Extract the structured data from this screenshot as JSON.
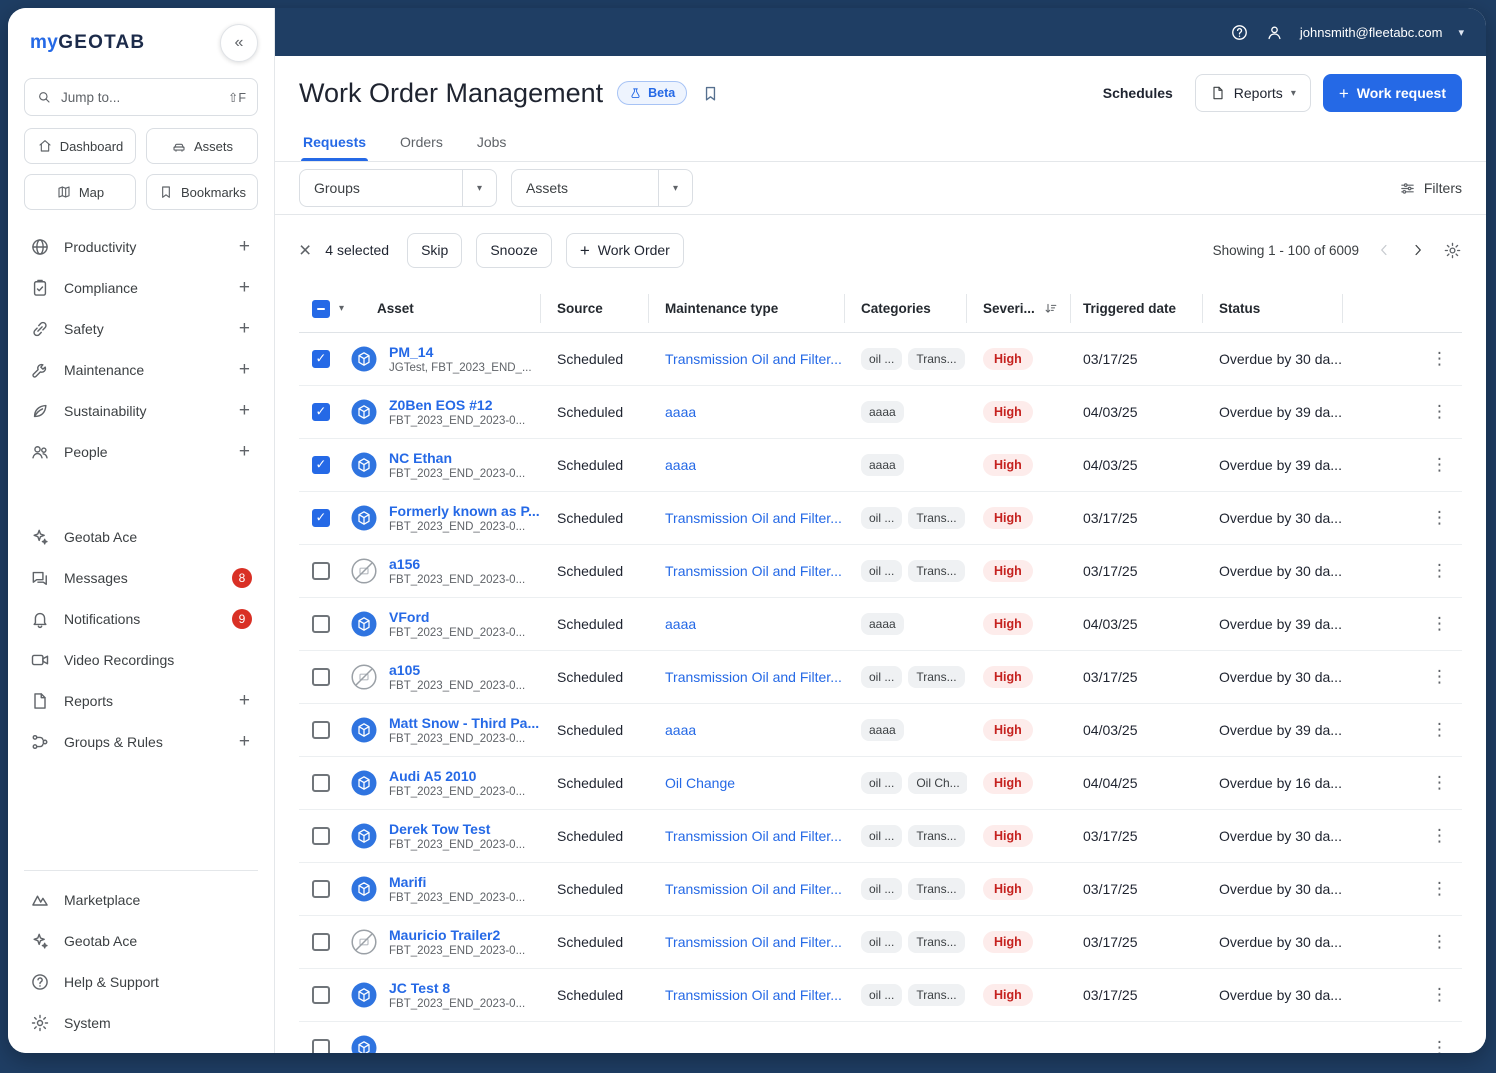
{
  "colors": {
    "navy": "#1f3e64",
    "accent": "#2569e6",
    "badge_red": "#d93025",
    "severity_high_bg": "#fdeceb",
    "severity_high_text": "#c5221f"
  },
  "topbar": {
    "email": "johnsmith@fleetabc.com"
  },
  "sidebar": {
    "logo_my": "my",
    "logo_geotab": "GEOTAB",
    "search_placeholder": "Jump to...",
    "search_shortcut": "⇧F",
    "quick_links": [
      {
        "label": "Dashboard",
        "icon": "home-icon"
      },
      {
        "label": "Assets",
        "icon": "car-icon"
      },
      {
        "label": "Map",
        "icon": "map-icon"
      },
      {
        "label": "Bookmarks",
        "icon": "bookmark-icon"
      }
    ],
    "nav_items": [
      {
        "label": "Productivity",
        "icon": "globe-icon",
        "plus": true
      },
      {
        "label": "Compliance",
        "icon": "clipboard-icon",
        "plus": true
      },
      {
        "label": "Safety",
        "icon": "link-icon",
        "plus": true
      },
      {
        "label": "Maintenance",
        "icon": "wrench-icon",
        "plus": true
      },
      {
        "label": "Sustainability",
        "icon": "leaf-icon",
        "plus": true
      },
      {
        "label": "People",
        "icon": "people-icon",
        "plus": true
      }
    ],
    "tool_items": [
      {
        "label": "Geotab Ace",
        "icon": "sparkle-icon"
      },
      {
        "label": "Messages",
        "icon": "chat-icon",
        "badge": "8"
      },
      {
        "label": "Notifications",
        "icon": "bell-icon",
        "badge": "9"
      },
      {
        "label": "Video Recordings",
        "icon": "video-camera-icon"
      },
      {
        "label": "Reports",
        "icon": "document-icon",
        "plus": true
      },
      {
        "label": "Groups & Rules",
        "icon": "hierarchy-icon",
        "plus": true
      }
    ],
    "bottom_items": [
      {
        "label": "Marketplace",
        "icon": "mountains-icon"
      },
      {
        "label": "Geotab Ace",
        "icon": "sparkle-icon"
      },
      {
        "label": "Help & Support",
        "icon": "help-icon"
      },
      {
        "label": "System",
        "icon": "gear-icon"
      }
    ]
  },
  "header": {
    "title": "Work Order Management",
    "beta_label": "Beta",
    "schedules_label": "Schedules",
    "reports_label": "Reports",
    "work_request_label": "Work request"
  },
  "tabs": [
    {
      "label": "Requests",
      "active": true
    },
    {
      "label": "Orders",
      "active": false
    },
    {
      "label": "Jobs",
      "active": false
    }
  ],
  "filter_bar": {
    "groups_value": "Groups",
    "assets_value": "Assets",
    "filters_label": "Filters"
  },
  "toolbar": {
    "selected_count": "4 selected",
    "skip_label": "Skip",
    "snooze_label": "Snooze",
    "work_order_label": "Work Order",
    "showing_label": "Showing 1 - 100 of 6009"
  },
  "table": {
    "columns": [
      "Asset",
      "Source",
      "Maintenance type",
      "Categories",
      "Severi...",
      "Triggered date",
      "Status"
    ],
    "rows": [
      {
        "name": "PM_14",
        "subtitle": "JGTest, FBT_2023_END_...",
        "icon": "geotab-asset-icon",
        "checked": true,
        "source": "Scheduled",
        "maintenance": "Transmission Oil and Filter...",
        "categories": [
          "oil ...",
          "Trans..."
        ],
        "severity": "High",
        "triggered_date": "03/17/25",
        "status": "Overdue by 30 da..."
      },
      {
        "name": "Z0Ben EOS #12",
        "subtitle": "FBT_2023_END_2023-0...",
        "icon": "geotab-asset-icon",
        "checked": true,
        "source": "Scheduled",
        "maintenance": "aaaa",
        "categories": [
          "aaaa"
        ],
        "severity": "High",
        "triggered_date": "04/03/25",
        "status": "Overdue by 39 da..."
      },
      {
        "name": "NC Ethan",
        "subtitle": "FBT_2023_END_2023-0...",
        "icon": "geotab-asset-icon",
        "checked": true,
        "source": "Scheduled",
        "maintenance": "aaaa",
        "categories": [
          "aaaa"
        ],
        "severity": "High",
        "triggered_date": "04/03/25",
        "status": "Overdue by 39 da..."
      },
      {
        "name": "Formerly known as P...",
        "subtitle": "FBT_2023_END_2023-0...",
        "icon": "geotab-asset-icon",
        "checked": true,
        "source": "Scheduled",
        "maintenance": "Transmission Oil and Filter...",
        "categories": [
          "oil ...",
          "Trans..."
        ],
        "severity": "High",
        "triggered_date": "03/17/25",
        "status": "Overdue by 30 da..."
      },
      {
        "name": "a156",
        "subtitle": "FBT_2023_END_2023-0...",
        "icon": "no-device-icon",
        "checked": false,
        "source": "Scheduled",
        "maintenance": "Transmission Oil and Filter...",
        "categories": [
          "oil ...",
          "Trans..."
        ],
        "severity": "High",
        "triggered_date": "03/17/25",
        "status": "Overdue by 30 da..."
      },
      {
        "name": "VFord",
        "subtitle": "FBT_2023_END_2023-0...",
        "icon": "geotab-asset-icon",
        "checked": false,
        "source": "Scheduled",
        "maintenance": "aaaa",
        "categories": [
          "aaaa"
        ],
        "severity": "High",
        "triggered_date": "04/03/25",
        "status": "Overdue by 39 da..."
      },
      {
        "name": "a105",
        "subtitle": "FBT_2023_END_2023-0...",
        "icon": "no-device-icon",
        "checked": false,
        "source": "Scheduled",
        "maintenance": "Transmission Oil and Filter...",
        "categories": [
          "oil ...",
          "Trans..."
        ],
        "severity": "High",
        "triggered_date": "03/17/25",
        "status": "Overdue by 30 da..."
      },
      {
        "name": "Matt Snow - Third Pa...",
        "subtitle": "FBT_2023_END_2023-0...",
        "icon": "geotab-asset-icon",
        "checked": false,
        "source": "Scheduled",
        "maintenance": "aaaa",
        "categories": [
          "aaaa"
        ],
        "severity": "High",
        "triggered_date": "04/03/25",
        "status": "Overdue by 39 da..."
      },
      {
        "name": "Audi A5 2010",
        "subtitle": "FBT_2023_END_2023-0...",
        "icon": "geotab-asset-icon",
        "checked": false,
        "source": "Scheduled",
        "maintenance": "Oil Change",
        "categories": [
          "oil ...",
          "Oil Ch..."
        ],
        "severity": "High",
        "triggered_date": "04/04/25",
        "status": "Overdue by 16 da..."
      },
      {
        "name": "Derek Tow Test",
        "subtitle": "FBT_2023_END_2023-0...",
        "icon": "geotab-asset-icon",
        "checked": false,
        "source": "Scheduled",
        "maintenance": "Transmission Oil and Filter...",
        "categories": [
          "oil ...",
          "Trans..."
        ],
        "severity": "High",
        "triggered_date": "03/17/25",
        "status": "Overdue by 30 da..."
      },
      {
        "name": "Marifi",
        "subtitle": "FBT_2023_END_2023-0...",
        "icon": "geotab-asset-icon",
        "checked": false,
        "source": "Scheduled",
        "maintenance": "Transmission Oil and Filter...",
        "categories": [
          "oil ...",
          "Trans..."
        ],
        "severity": "High",
        "triggered_date": "03/17/25",
        "status": "Overdue by 30 da..."
      },
      {
        "name": "Mauricio Trailer2",
        "subtitle": "FBT_2023_END_2023-0...",
        "icon": "no-device-icon",
        "checked": false,
        "source": "Scheduled",
        "maintenance": "Transmission Oil and Filter...",
        "categories": [
          "oil ...",
          "Trans..."
        ],
        "severity": "High",
        "triggered_date": "03/17/25",
        "status": "Overdue by 30 da..."
      },
      {
        "name": "JC Test 8",
        "subtitle": "FBT_2023_END_2023-0...",
        "icon": "geotab-asset-icon",
        "checked": false,
        "source": "Scheduled",
        "maintenance": "Transmission Oil and Filter...",
        "categories": [
          "oil ...",
          "Trans..."
        ],
        "severity": "High",
        "triggered_date": "03/17/25",
        "status": "Overdue by 30 da..."
      }
    ]
  }
}
